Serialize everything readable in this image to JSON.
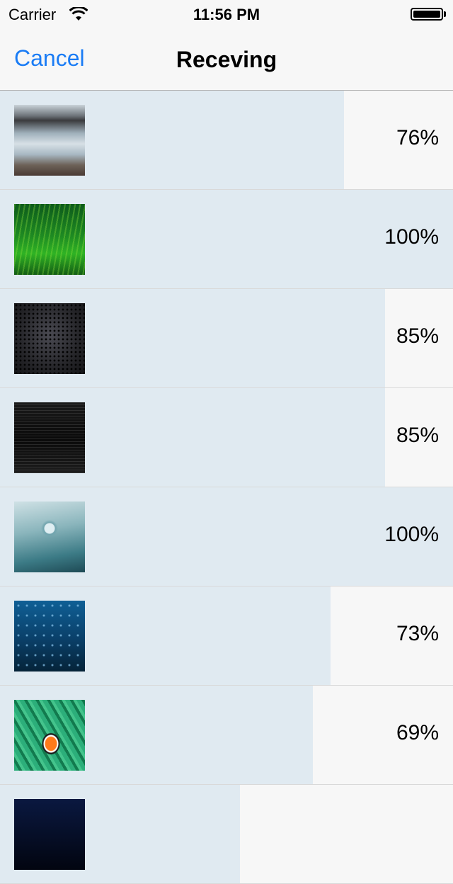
{
  "status_bar": {
    "carrier": "Carrier",
    "time": "11:56 PM",
    "icons": [
      "wifi-icon",
      "battery-icon"
    ]
  },
  "nav": {
    "cancel_label": "Cancel",
    "title": "Receving"
  },
  "colors": {
    "accent": "#1a7cf5",
    "progress_fill": "#e0eaf1",
    "row_background": "#f7f7f7"
  },
  "items": [
    {
      "image": "river-photo",
      "percent_label": "76%",
      "progress": 0.76
    },
    {
      "image": "grass-photo",
      "percent_label": "100%",
      "progress": 1.0
    },
    {
      "image": "apple-mesh-photo",
      "percent_label": "85%",
      "progress": 0.85
    },
    {
      "image": "dark-texture-photo",
      "percent_label": "85%",
      "progress": 0.85
    },
    {
      "image": "water-drop-photo",
      "percent_label": "100%",
      "progress": 1.0
    },
    {
      "image": "underwater-photo",
      "percent_label": "73%",
      "progress": 0.73
    },
    {
      "image": "clownfish-photo",
      "percent_label": "69%",
      "progress": 0.69
    },
    {
      "image": "night-photo",
      "percent_label": "",
      "progress": 0.53
    }
  ]
}
